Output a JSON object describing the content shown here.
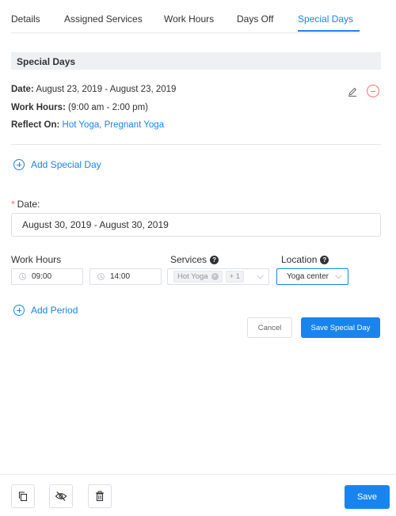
{
  "tabs": [
    {
      "label": "Details"
    },
    {
      "label": "Assigned Services"
    },
    {
      "label": "Work Hours"
    },
    {
      "label": "Days Off"
    },
    {
      "label": "Special Days",
      "active": true
    }
  ],
  "special_days": {
    "header": "Special Days",
    "entry": {
      "date_label": "Date:",
      "date_value": "August 23, 2019 - August 23, 2019",
      "work_hours_label": "Work Hours:",
      "work_hours_value": "(9:00 am - 2:00 pm)",
      "reflect_on_label": "Reflect On:",
      "reflect_on_value": "Hot Yoga, Pregnant Yoga"
    },
    "add_special_day_label": "Add Special Day"
  },
  "form": {
    "date_label": "Date:",
    "required_mark": "*",
    "date_value": "August 30, 2019 - August 30, 2019",
    "work_hours_label": "Work Hours",
    "services_label": "Services",
    "location_label": "Location",
    "help_glyph": "?",
    "start_time": "09:00",
    "end_time": "14:00",
    "services_tag": "Hot Yoga",
    "services_more": "+ 1",
    "tag_close_glyph": "×",
    "location_value": "Yoga center",
    "add_period_label": "Add Period",
    "cancel_label": "Cancel",
    "save_special_day_label": "Save Special Day"
  },
  "footer": {
    "icons": [
      "copy-icon",
      "eye-off-icon",
      "trash-icon"
    ],
    "save_label": "Save"
  },
  "colors": {
    "accent": "#1a84ee",
    "danger": "#f56c6c",
    "section_bg": "#eef0f3",
    "border": "#dcdfe6"
  }
}
